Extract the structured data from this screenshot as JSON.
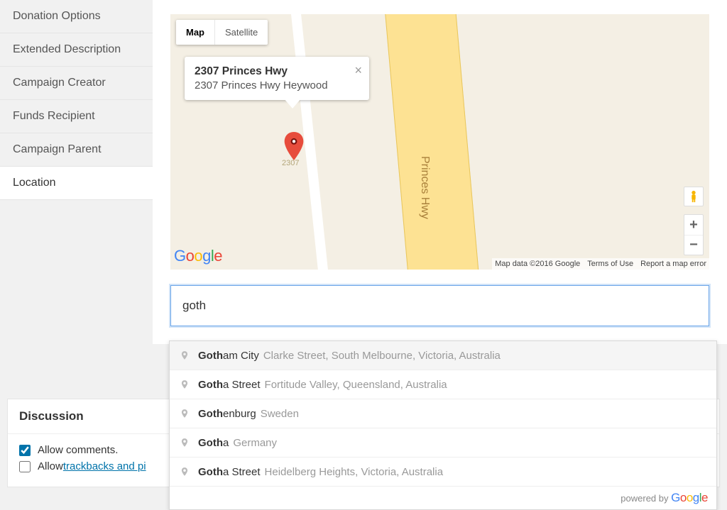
{
  "sidebar": {
    "items": [
      {
        "label": "Donation Options"
      },
      {
        "label": "Extended Description"
      },
      {
        "label": "Campaign Creator"
      },
      {
        "label": "Funds Recipient"
      },
      {
        "label": "Campaign Parent"
      },
      {
        "label": "Location"
      }
    ]
  },
  "map": {
    "view_buttons": {
      "map": "Map",
      "satellite": "Satellite"
    },
    "info": {
      "title": "2307 Princes Hwy",
      "subtitle": "2307 Princes Hwy Heywood"
    },
    "marker_number": "2307",
    "road_label": "Princes Hwy",
    "footer": {
      "data": "Map data ©2016 Google",
      "terms": "Terms of Use",
      "report": "Report a map error"
    },
    "zoom": {
      "in": "+",
      "out": "−"
    }
  },
  "search": {
    "value": "goth"
  },
  "autocomplete": {
    "items": [
      {
        "match": "Goth",
        "rest": "am City",
        "secondary": "Clarke Street, South Melbourne, Victoria, Australia"
      },
      {
        "match": "Goth",
        "rest": "a Street",
        "secondary": "Fortitude Valley, Queensland, Australia"
      },
      {
        "match": "Goth",
        "rest": "enburg",
        "secondary": "Sweden"
      },
      {
        "match": "Goth",
        "rest": "a",
        "secondary": "Germany"
      },
      {
        "match": "Goth",
        "rest": "a Street",
        "secondary": "Heidelberg Heights, Victoria, Australia"
      }
    ],
    "footer": "powered by "
  },
  "discussion": {
    "title": "Discussion",
    "allow_comments": "Allow comments.",
    "allow_trackbacks_prefix": "Allow ",
    "allow_trackbacks_link": "trackbacks and pi"
  }
}
